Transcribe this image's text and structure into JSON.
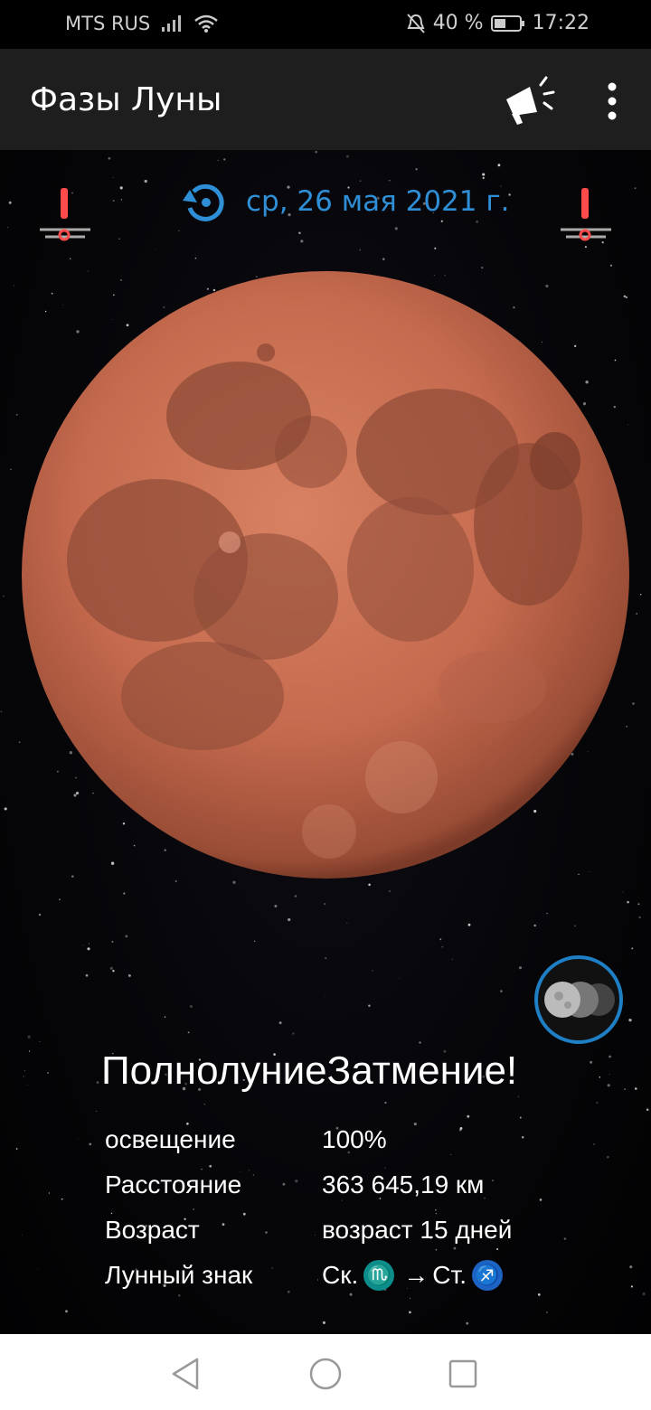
{
  "status_bar": {
    "carrier": "MTS RUS",
    "battery": "40 %",
    "time": "17:22"
  },
  "app_bar": {
    "title": "Фазы Луны",
    "icons": [
      "announce-icon",
      "more-vert-icon"
    ]
  },
  "date_row": {
    "date": "ср, 26 мая 2021 г.",
    "icon": "reset-date-icon"
  },
  "eclipse_alerts": {
    "left_icon": "eclipse-alert-icon",
    "right_icon": "eclipse-alert-icon",
    "color": "#ff4b4b"
  },
  "moon": {
    "color": "#c56a4e",
    "illumination_fraction": 1.0
  },
  "phase": {
    "title": "ПолнолуниеЗатмение!"
  },
  "info": {
    "illumination_label": "освещение",
    "illumination_value": "100%",
    "distance_label": "Расстояние",
    "distance_value": "363 645,19 км",
    "age_label": "Возраст",
    "age_value": "возраст 15 дней",
    "sign_label": "Лунный знак",
    "sign_from": "Ск.",
    "sign_from_symbol": "♏",
    "sign_arrow": "→",
    "sign_to": "Ст.",
    "sign_to_symbol": "♐"
  },
  "colors": {
    "accent": "#2e8fd6",
    "app_bar": "#1e1e1e",
    "scorpio": "#0d8c8c",
    "sagittarius": "#1d63c4"
  },
  "nav_bar": {
    "icons": [
      "back-icon",
      "home-icon",
      "recents-icon"
    ]
  }
}
